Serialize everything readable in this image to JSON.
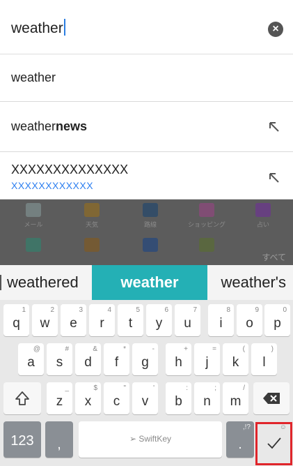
{
  "search": {
    "query": "weather"
  },
  "suggestions": [
    {
      "text": "weather"
    },
    {
      "prefix": "weather",
      "bold": "news"
    },
    {
      "text": "XXXXXXXXXXXXXX",
      "sub": "XXXXXXXXXXXX"
    }
  ],
  "app_grid": {
    "apps": [
      {
        "label": "メール",
        "icon": "mail-icon",
        "color": "#7a8a8a"
      },
      {
        "label": "天気",
        "icon": "weather-icon",
        "color": "#8a6a2a"
      },
      {
        "label": "路線",
        "icon": "train-icon",
        "color": "#2a4a6a"
      },
      {
        "label": "ショッピング",
        "icon": "cart-icon",
        "color": "#8a4a7a"
      },
      {
        "label": "占い",
        "icon": "star-icon",
        "color": "#6a3a8a"
      },
      {
        "label": "",
        "icon": "transfer-icon",
        "color": "#3a7a6a"
      },
      {
        "label": "",
        "icon": "auction-icon",
        "color": "#7a5a2a"
      },
      {
        "label": "",
        "icon": "finance-icon",
        "color": "#2a4a7a"
      },
      {
        "label": "",
        "icon": "shield-icon",
        "color": "#5a6a3a"
      }
    ],
    "all_label": "すべて"
  },
  "candidates": {
    "left": "weathered",
    "middle": "weather",
    "right": "weather's"
  },
  "keyboard": {
    "row1": [
      {
        "key": "q",
        "hint": "1"
      },
      {
        "key": "w",
        "hint": "2"
      },
      {
        "key": "e",
        "hint": "3"
      },
      {
        "key": "r",
        "hint": "4"
      },
      {
        "key": "t",
        "hint": "5"
      },
      {
        "key": "y",
        "hint": "6"
      },
      {
        "key": "u",
        "hint": "7"
      },
      {
        "key": "i",
        "hint": "8"
      },
      {
        "key": "o",
        "hint": "9"
      },
      {
        "key": "p",
        "hint": "0"
      }
    ],
    "row2": [
      {
        "key": "a",
        "hint": "@"
      },
      {
        "key": "s",
        "hint": "#"
      },
      {
        "key": "d",
        "hint": "&"
      },
      {
        "key": "f",
        "hint": "*"
      },
      {
        "key": "g",
        "hint": "-"
      },
      {
        "key": "h",
        "hint": "+"
      },
      {
        "key": "j",
        "hint": "="
      },
      {
        "key": "k",
        "hint": "("
      },
      {
        "key": "l",
        "hint": ")"
      }
    ],
    "row3": [
      {
        "key": "z",
        "hint": "_"
      },
      {
        "key": "x",
        "hint": "$"
      },
      {
        "key": "c",
        "hint": "\""
      },
      {
        "key": "v",
        "hint": "'"
      },
      {
        "key": "b",
        "hint": ":"
      },
      {
        "key": "n",
        "hint": ";"
      },
      {
        "key": "m",
        "hint": "/"
      }
    ],
    "numbers_label": "123",
    "comma_label": ",",
    "space_label": "SwiftKey",
    "period_label": ".",
    "period_hint": ",!?",
    "enter_hint": "☺"
  }
}
